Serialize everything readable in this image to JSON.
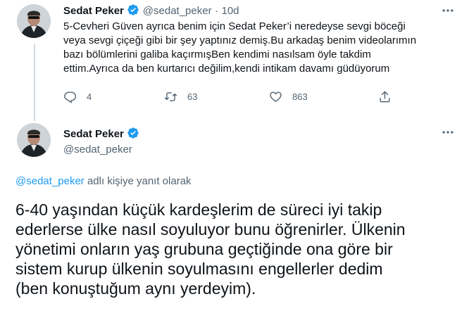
{
  "tweet1": {
    "name": "Sedat Peker",
    "handle": "@sedat_peker",
    "separator": "·",
    "time": "10d",
    "lines": [
      "5-Cevheri Güven ayrıca benim için Sedat Peker’i neredeyse sevgi böceği",
      "veya sevgi çiçeği gibi bir şey yaptınız demiş.Bu arkadaş benim videolarımın",
      "bazı bölümlerini galiba kaçırmışBen kendimi nasılsam öyle takdim",
      "ettim.Ayrıca da ben kurtarıcı değilim,kendi intikam davamı güdüyorum"
    ],
    "actions": {
      "replies": "4",
      "retweets": "63",
      "likes": "863"
    }
  },
  "tweet2": {
    "name": "Sedat Peker",
    "handle": "@sedat_peker",
    "reply_to_handle": "@sedat_peker",
    "reply_to_suffix": " adlı kişiye yanıt olarak",
    "lines": [
      "6-40 yaşından küçük kardeşlerim de süreci iyi takip",
      "ederlerse ülke nasıl soyuluyor bunu öğrenirler. Ülkenin",
      "yönetimi onların yaş grubuna geçtiğinde ona göre bir",
      "sistem kurup ülkenin soyulmasını engellerler dedim",
      "(ben konuştuğum aynı yerdeyim)."
    ]
  },
  "colors": {
    "accent": "#1d9bf0",
    "secondary_text": "#536471",
    "thread_line": "#cfd9de"
  },
  "icons": [
    "verified-badge-icon",
    "more-icon",
    "reply-icon",
    "retweet-icon",
    "like-icon",
    "share-icon"
  ]
}
